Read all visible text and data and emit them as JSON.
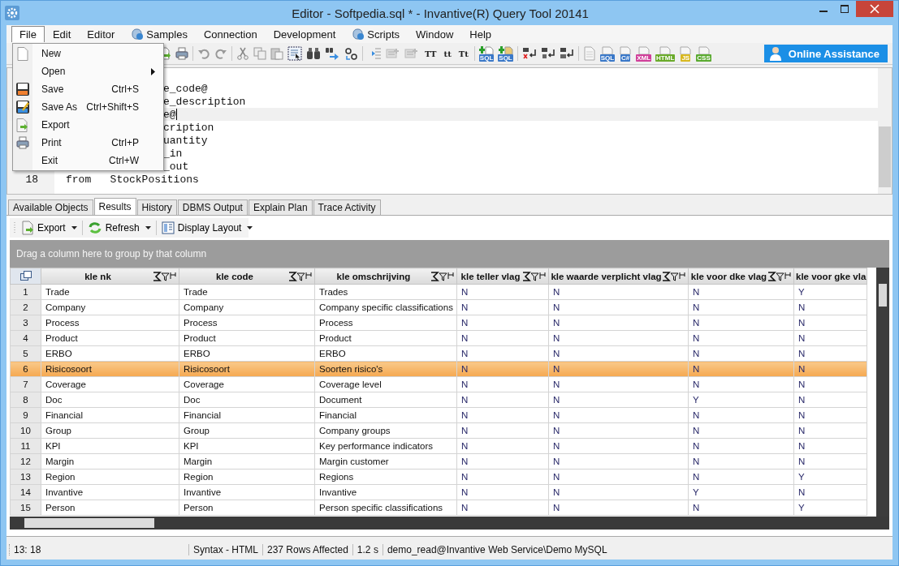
{
  "window": {
    "title": "Editor - Softpedia.sql * - Invantive(R) Query Tool 20141"
  },
  "menu_bar": [
    {
      "label": "File",
      "selected": true,
      "icon": false
    },
    {
      "label": "Edit",
      "selected": false,
      "icon": false
    },
    {
      "label": "Editor",
      "selected": false,
      "icon": false
    },
    {
      "label": "Samples",
      "selected": false,
      "icon": true
    },
    {
      "label": "Connection",
      "selected": false,
      "icon": false
    },
    {
      "label": "Development",
      "selected": false,
      "icon": false
    },
    {
      "label": "Scripts",
      "selected": false,
      "icon": true
    },
    {
      "label": "Window",
      "selected": false,
      "icon": false
    },
    {
      "label": "Help",
      "selected": false,
      "icon": false
    }
  ],
  "file_menu": [
    {
      "label": "New",
      "submenu": false
    },
    {
      "label": "Open",
      "submenu": true
    },
    {
      "label": "Save",
      "shortcut": "Ctrl+S",
      "submenu": false
    },
    {
      "label": "Save As",
      "shortcut": "Ctrl+Shift+S",
      "submenu": false
    },
    {
      "label": "Export",
      "submenu": false
    },
    {
      "label": "Print",
      "shortcut": "Ctrl+P",
      "submenu": false
    },
    {
      "label": "Exit",
      "shortcut": "Ctrl+W",
      "submenu": false
    }
  ],
  "toolbar": {
    "case_buttons": [
      "TT",
      "tt",
      "Tt"
    ],
    "add_badges": [
      "SQL",
      "SQL"
    ],
    "file_badges": [
      {
        "label": "SQL",
        "color": "#3a78c8"
      },
      {
        "label": "C#",
        "color": "#3a78c8"
      },
      {
        "label": "XML",
        "color": "#d0409a"
      },
      {
        "label": "HTML",
        "color": "#6aaa2a"
      },
      {
        "label": "JS",
        "color": "#d8b820"
      },
      {
        "label": "CSS",
        "color": "#5aaa30"
      }
    ],
    "assist_button": "Online Assistance"
  },
  "editor": {
    "lines": [
      {
        "kind": "blank",
        "current": false
      },
      {
        "kind": "partial",
        "code": "e_code@",
        "current": false
      },
      {
        "kind": "partial",
        "code": "e_description",
        "current": false
      },
      {
        "kind": "partial",
        "code": "e@",
        "current": true
      },
      {
        "kind": "partial",
        "code": "cription",
        "current": false
      },
      {
        "kind": "partial",
        "code": "uantity",
        "current": false
      },
      {
        "kind": "partial",
        "code": "_in",
        "current": false
      },
      {
        "kind": "partial",
        "code": "_out",
        "current": false
      },
      {
        "kind": "full",
        "number": "18",
        "code": "from   StockPositions",
        "current": false
      }
    ]
  },
  "tabs": [
    {
      "label": "Available Objects",
      "selected": false
    },
    {
      "label": "Results",
      "selected": true
    },
    {
      "label": "History",
      "selected": false
    },
    {
      "label": "DBMS Output",
      "selected": false
    },
    {
      "label": "Explain Plan",
      "selected": false
    },
    {
      "label": "Trace Activity",
      "selected": false
    }
  ],
  "results_toolbar": [
    "Export",
    "Refresh",
    "Display Layout"
  ],
  "group_bar": "Drag a column here to group by that column",
  "table": {
    "columns": [
      "",
      "kle nk",
      "kle code",
      "kle omschrijving",
      "kle teller vlag",
      "kle waarde verplicht vlag",
      "kle voor dke vlag",
      "kle voor gke vla"
    ],
    "rows": [
      {
        "cells": [
          "1",
          "Trade",
          "Trade",
          "Trades",
          "N",
          "N",
          "N",
          "Y"
        ],
        "selected": false
      },
      {
        "cells": [
          "2",
          "Company",
          "Company",
          "Company specific classifications",
          "N",
          "N",
          "N",
          "N"
        ],
        "selected": false
      },
      {
        "cells": [
          "3",
          "Process",
          "Process",
          "Process",
          "N",
          "N",
          "N",
          "N"
        ],
        "selected": false
      },
      {
        "cells": [
          "4",
          "Product",
          "Product",
          "Product",
          "N",
          "N",
          "N",
          "N"
        ],
        "selected": false
      },
      {
        "cells": [
          "5",
          "ERBO",
          "ERBO",
          "ERBO",
          "N",
          "N",
          "N",
          "N"
        ],
        "selected": false
      },
      {
        "cells": [
          "6",
          "Risicosoort",
          "Risicosoort",
          "Soorten risico's",
          "N",
          "N",
          "N",
          "N"
        ],
        "selected": true
      },
      {
        "cells": [
          "7",
          "Coverage",
          "Coverage",
          "Coverage level",
          "N",
          "N",
          "N",
          "N"
        ],
        "selected": false
      },
      {
        "cells": [
          "8",
          "Doc",
          "Doc",
          "Document",
          "N",
          "N",
          "Y",
          "N"
        ],
        "selected": false
      },
      {
        "cells": [
          "9",
          "Financial",
          "Financial",
          "Financial",
          "N",
          "N",
          "N",
          "N"
        ],
        "selected": false
      },
      {
        "cells": [
          "10",
          "Group",
          "Group",
          "Company groups",
          "N",
          "N",
          "N",
          "N"
        ],
        "selected": false
      },
      {
        "cells": [
          "11",
          "KPI",
          "KPI",
          "Key performance indicators",
          "N",
          "N",
          "N",
          "N"
        ],
        "selected": false
      },
      {
        "cells": [
          "12",
          "Margin",
          "Margin",
          "Margin customer",
          "N",
          "N",
          "N",
          "N"
        ],
        "selected": false
      },
      {
        "cells": [
          "13",
          "Region",
          "Region",
          "Regions",
          "N",
          "N",
          "N",
          "Y"
        ],
        "selected": false
      },
      {
        "cells": [
          "14",
          "Invantive",
          "Invantive",
          "Invantive",
          "N",
          "N",
          "Y",
          "N"
        ],
        "selected": false
      },
      {
        "cells": [
          "15",
          "Person",
          "Person",
          "Person specific classifications",
          "N",
          "N",
          "N",
          "Y"
        ],
        "selected": false
      }
    ]
  },
  "status_bar": [
    "13: 18",
    "Syntax - HTML",
    "237 Rows Affected",
    "1.2 s",
    "demo_read@Invantive Web Service\\Demo MySQL"
  ]
}
